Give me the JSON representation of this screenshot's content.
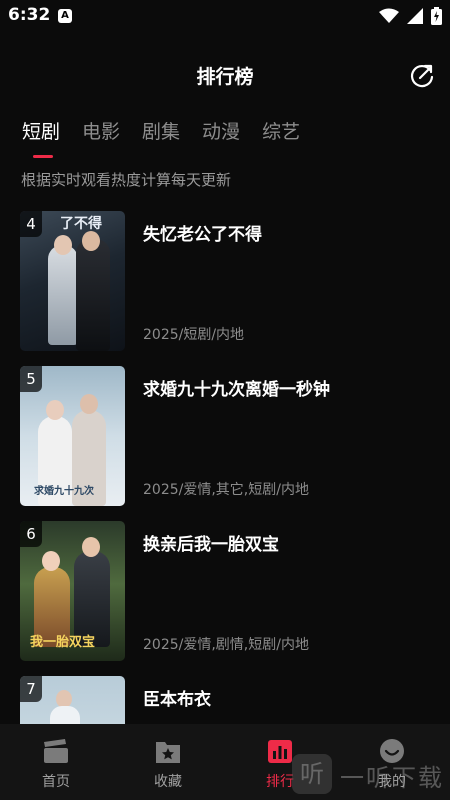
{
  "status_bar": {
    "time": "6:32",
    "badge": "A"
  },
  "header": {
    "title": "排行榜"
  },
  "tabs": [
    {
      "label": "短剧",
      "active": true
    },
    {
      "label": "电影",
      "active": false
    },
    {
      "label": "剧集",
      "active": false
    },
    {
      "label": "动漫",
      "active": false
    },
    {
      "label": "综艺",
      "active": false
    }
  ],
  "subtitle": "根据实时观看热度计算每天更新",
  "items": [
    {
      "rank": "4",
      "title": "失忆老公了不得",
      "meta": "2025/短剧/内地",
      "poster_text": "了不得"
    },
    {
      "rank": "5",
      "title": "求婚九十九次离婚一秒钟",
      "meta": "2025/爱情,其它,短剧/内地",
      "poster_text": "求婚九十九次"
    },
    {
      "rank": "6",
      "title": "换亲后我一胎双宝",
      "meta": "2025/爱情,剧情,短剧/内地",
      "poster_text": "我一胎双宝"
    },
    {
      "rank": "7",
      "title": "臣本布衣",
      "meta": "",
      "poster_text": ""
    }
  ],
  "bottom_nav": [
    {
      "label": "首页",
      "icon": "clapperboard-icon",
      "active": false
    },
    {
      "label": "收藏",
      "icon": "star-box-icon",
      "active": false
    },
    {
      "label": "排行",
      "icon": "bar-chart-icon",
      "active": true
    },
    {
      "label": "我的",
      "icon": "profile-face-icon",
      "active": false
    }
  ],
  "watermark": {
    "text": "一听下载",
    "glyph": "听"
  },
  "colors": {
    "accent": "#ee2b48",
    "background": "#0b0b0b"
  }
}
